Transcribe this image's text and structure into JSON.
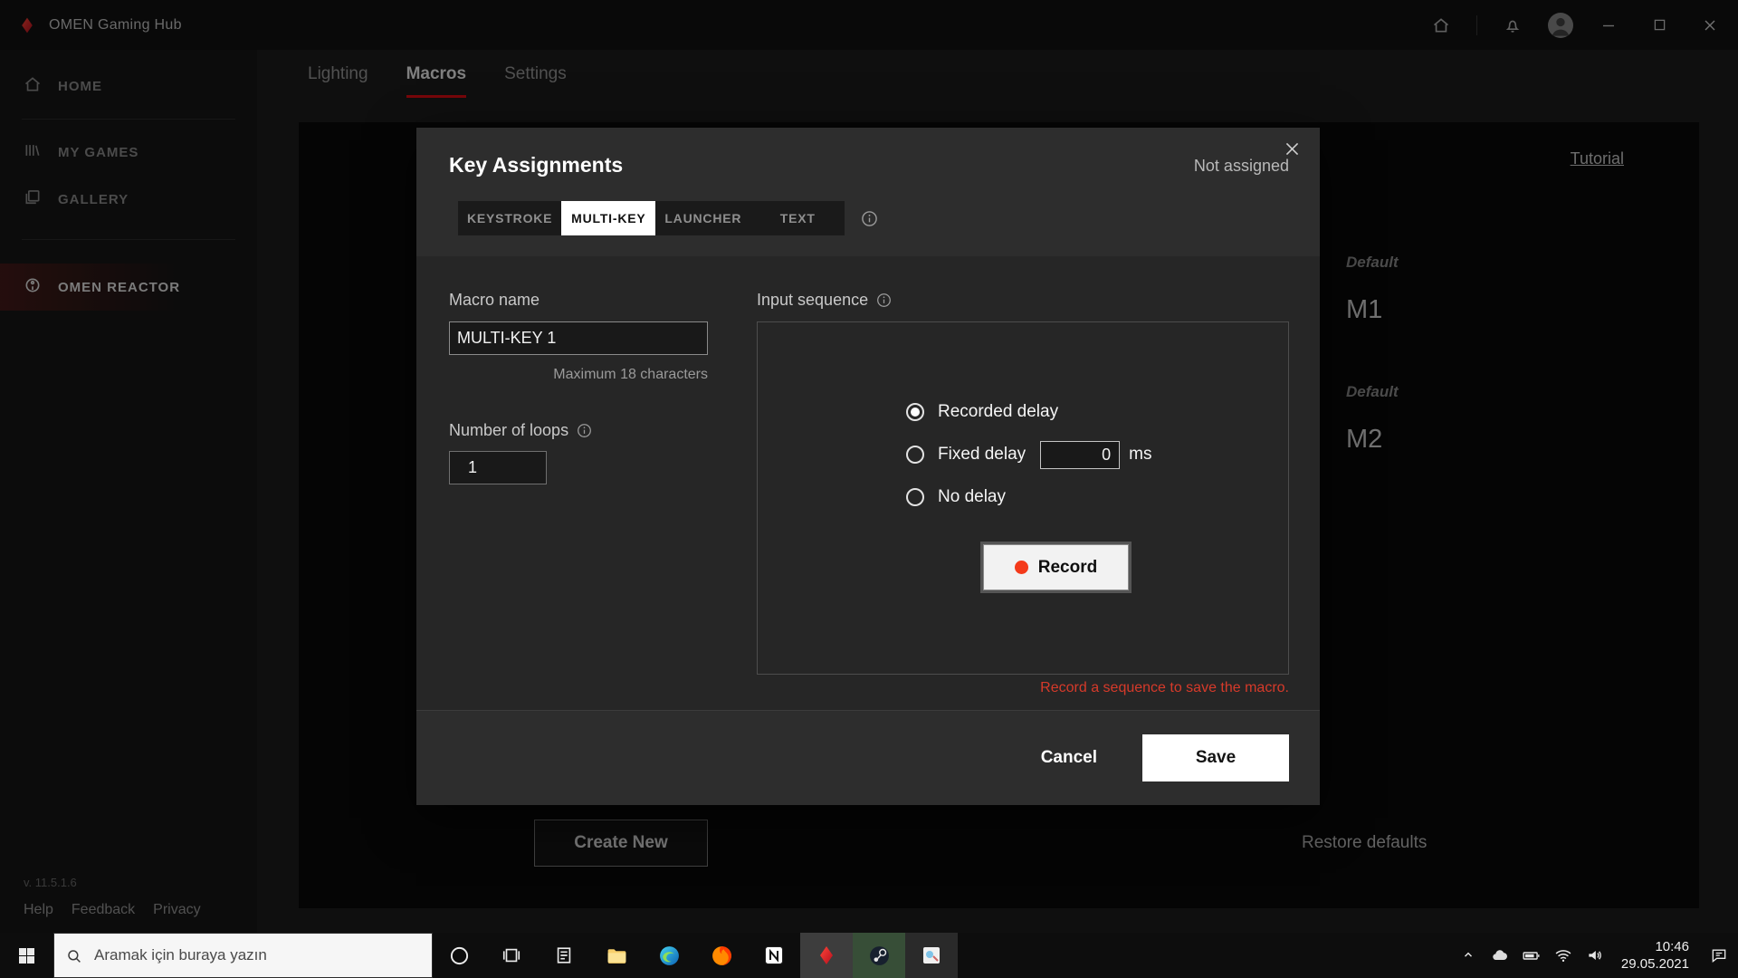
{
  "titlebar": {
    "app_title": "OMEN Gaming Hub",
    "icons": [
      "omen-logo",
      "home-icon",
      "bell-icon",
      "avatar",
      "minimize",
      "maximize",
      "close"
    ]
  },
  "sidebar": {
    "items": [
      {
        "label": "HOME",
        "icon": "home-icon",
        "selected": false
      },
      {
        "label": "MY GAMES",
        "icon": "games-icon",
        "selected": false
      },
      {
        "label": "GALLERY",
        "icon": "gallery-icon",
        "selected": false
      },
      {
        "label": "OMEN REACTOR",
        "icon": "reactor-icon",
        "selected": true
      }
    ],
    "version": "v. 11.5.1.6",
    "links": [
      {
        "label": "Help"
      },
      {
        "label": "Feedback"
      },
      {
        "label": "Privacy"
      }
    ]
  },
  "main": {
    "tabs": [
      {
        "label": "Lighting",
        "active": false
      },
      {
        "label": "Macros",
        "active": true
      },
      {
        "label": "Settings",
        "active": false
      }
    ],
    "tutorial_link": "Tutorial",
    "macro_slots": [
      {
        "badge": "Default",
        "name": "M1"
      },
      {
        "badge": "Default",
        "name": "M2"
      }
    ],
    "create_new_button": "Create New",
    "restore_defaults": "Restore defaults"
  },
  "dialog": {
    "title": "Key Assignments",
    "assignment_status": "Not assigned",
    "tabs": [
      {
        "label": "KEYSTROKE",
        "active": false
      },
      {
        "label": "MULTI-KEY",
        "active": true
      },
      {
        "label": "LAUNCHER",
        "active": false
      },
      {
        "label": "TEXT",
        "active": false
      }
    ],
    "macro_name": {
      "label": "Macro name",
      "value": "MULTI-KEY 1",
      "helper": "Maximum 18 characters"
    },
    "loops": {
      "label": "Number of loops",
      "value": "1"
    },
    "input_sequence": {
      "label": "Input sequence"
    },
    "delay_options": [
      {
        "label": "Recorded delay",
        "selected": true
      },
      {
        "label": "Fixed delay",
        "selected": false,
        "value": "0",
        "unit": "ms"
      },
      {
        "label": "No delay",
        "selected": false
      }
    ],
    "record_button": "Record",
    "error_message": "Record a sequence to save the macro.",
    "cancel_button": "Cancel",
    "save_button": "Save"
  },
  "taskbar": {
    "search_placeholder": "Aramak için buraya yazın",
    "app_icons": [
      "start",
      "cortana",
      "task-view",
      "document",
      "file-explorer",
      "edge",
      "firefox",
      "notion",
      "omen",
      "steam",
      "paint"
    ],
    "tray_icons": [
      "chevron-up",
      "onedrive-cloud",
      "battery",
      "network",
      "volume",
      "action-center"
    ],
    "clock": {
      "time": "10:46",
      "date": "29.05.2021"
    }
  },
  "colors": {
    "accent_red": "#e00d13",
    "record_dot": "#f43a1a",
    "error_red": "#d63a2a",
    "active_tab_bg": "#ffffff"
  }
}
